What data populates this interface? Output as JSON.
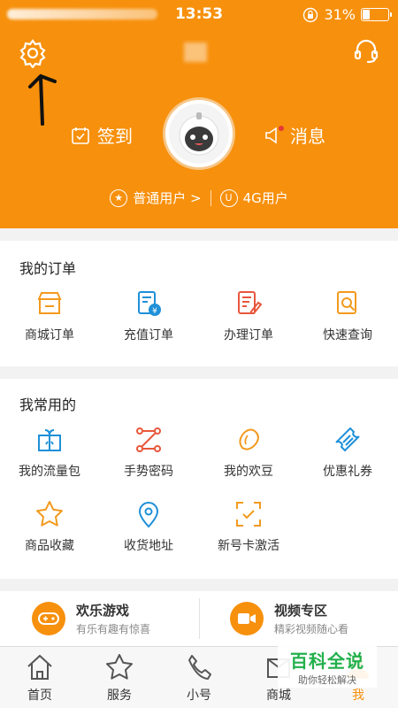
{
  "status_bar": {
    "time": "13:53",
    "battery": "31%",
    "battery_level": 0.31
  },
  "header": {
    "checkin_label": "签到",
    "message_label": "消息",
    "user_type_label": "普通用户 >",
    "user_type_icon": "★",
    "network_icon": "U",
    "network_label": "4G用户"
  },
  "orders": {
    "title": "我的订单",
    "items": [
      {
        "label": "商城订单",
        "icon": "shop-icon"
      },
      {
        "label": "充值订单",
        "icon": "recharge-icon"
      },
      {
        "label": "办理订单",
        "icon": "edit-doc-icon"
      },
      {
        "label": "快速查询",
        "icon": "search-doc-icon"
      }
    ]
  },
  "common": {
    "title": "我常用的",
    "items": [
      {
        "label": "我的流量包",
        "icon": "gift-icon"
      },
      {
        "label": "手势密码",
        "icon": "gesture-icon"
      },
      {
        "label": "我的欢豆",
        "icon": "bean-icon"
      },
      {
        "label": "优惠礼券",
        "icon": "ticket-icon"
      },
      {
        "label": "商品收藏",
        "icon": "star-icon"
      },
      {
        "label": "收货地址",
        "icon": "location-icon"
      },
      {
        "label": "新号卡激活",
        "icon": "scan-icon"
      }
    ]
  },
  "promos": [
    {
      "title": "欢乐游戏",
      "subtitle": "有乐有趣有惊喜",
      "icon": "gamepad-icon"
    },
    {
      "title": "视频专区",
      "subtitle": "精彩视频随心看",
      "icon": "video-icon"
    }
  ],
  "tabbar": {
    "items": [
      {
        "label": "首页",
        "icon": "home-icon"
      },
      {
        "label": "服务",
        "icon": "star-icon"
      },
      {
        "label": "小号",
        "icon": "phone-icon"
      },
      {
        "label": "商城",
        "icon": "mall-icon"
      },
      {
        "label": "我",
        "icon": "user-icon",
        "active": true
      }
    ]
  },
  "watermark": {
    "title": "百科全说",
    "subtitle": "助你轻松解决"
  },
  "colors": {
    "brand": "#f7900c",
    "icon_orange": "#f39a1e",
    "icon_blue": "#1e90d8",
    "icon_red": "#e8573c",
    "watermark_green": "#22b04b"
  }
}
